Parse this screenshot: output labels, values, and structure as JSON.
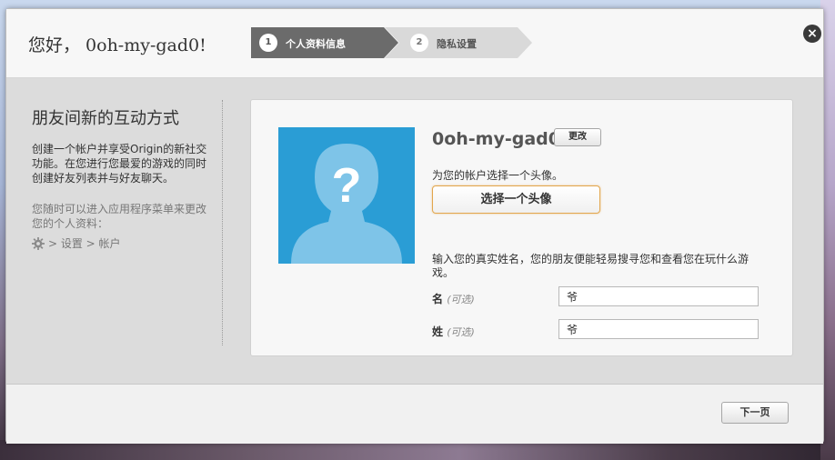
{
  "header": {
    "greeting": "您好， 0oh-my-gad0!",
    "steps": [
      {
        "num": "1",
        "label": "个人资料信息"
      },
      {
        "num": "2",
        "label": "隐私设置"
      }
    ],
    "close_icon": "×"
  },
  "sidebar": {
    "title": "朋友间新的互动方式",
    "description": "创建一个帐户并享受Origin的新社交功能。在您进行您最爱的游戏的同时创建好友列表并与好友聊天。",
    "note": "您随时可以进入应用程序菜单来更改您的个人资料：",
    "path": "> 设置 > 帐户"
  },
  "profile": {
    "username": "0oh-my-gad0",
    "edit_label": "更改",
    "avatar_prompt": "为您的帐户选择一个头像。",
    "choose_avatar_label": "选择一个头像",
    "realname_prompt": "输入您的真实姓名，您的朋友便能轻易搜寻您和查看您在玩什么游戏。",
    "first_name_label": "名",
    "first_name_optional": "(可选)",
    "first_name_value": "爷",
    "last_name_label": "姓",
    "last_name_optional": "(可选)",
    "last_name_value": "爷"
  },
  "footer": {
    "next_label": "下一页"
  },
  "colors": {
    "avatar_bg": "#2a9dd5",
    "avatar_figure": "#7ec4e8",
    "active_step": "#6b6b6b",
    "inactive_step": "#d9d9d9",
    "highlight_border": "#e2a64d"
  }
}
